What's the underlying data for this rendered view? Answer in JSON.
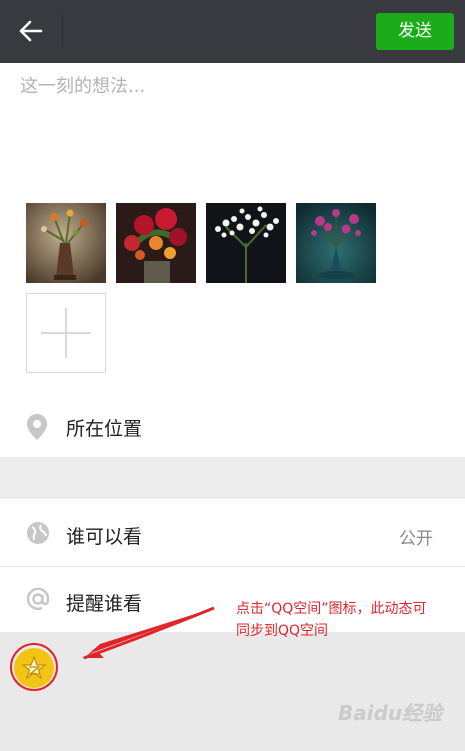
{
  "topbar": {
    "send_label": "发送"
  },
  "compose": {
    "placeholder": "这一刻的想法..."
  },
  "photos": [
    {
      "subject": "flowers in bronze vase"
    },
    {
      "subject": "red roses and lilies bouquet"
    },
    {
      "subject": "white lace flowers"
    },
    {
      "subject": "purple flowers in teal vase"
    }
  ],
  "options": {
    "location_label": "所在位置",
    "visibility_label": "谁可以看",
    "visibility_value": "公开",
    "mention_label": "提醒谁看"
  },
  "annotation": {
    "note_line1": "点击“QQ空间”图标，此动态可",
    "note_line2": "同步到QQ空间"
  },
  "watermark": "Baidu经验",
  "colors": {
    "topbar": "#393a3f",
    "send_button": "#1aad19",
    "annotation": "#e0252a",
    "qzone_icon": "#f3c414"
  }
}
